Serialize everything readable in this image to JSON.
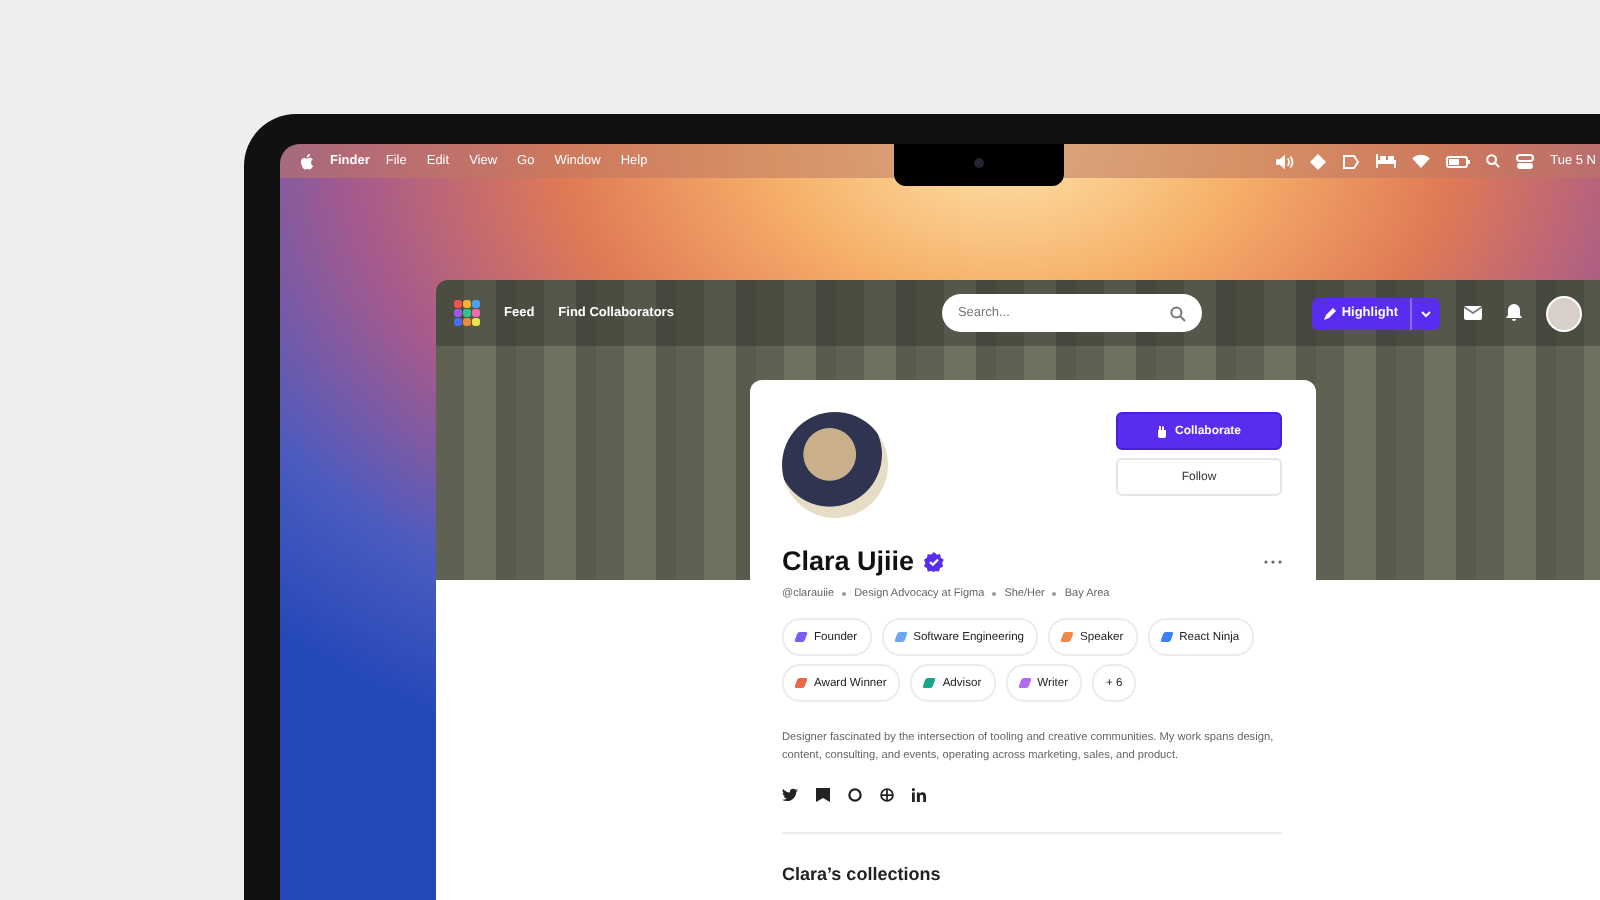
{
  "menubar": {
    "app": "Finder",
    "menus": [
      "File",
      "Edit",
      "View",
      "Go",
      "Window",
      "Help"
    ],
    "clock": "Tue 5 N"
  },
  "navbar": {
    "links": [
      "Feed",
      "Find Collaborators"
    ],
    "search": {
      "placeholder": "Search..."
    },
    "highlight_button": "Highlight"
  },
  "profile": {
    "name": "Clara Ujiie",
    "verified": true,
    "meta": [
      "@clarauiie",
      "Design Advocacy at Figma",
      "She/Her",
      "Bay Area"
    ],
    "actions": [
      {
        "label": "Collaborate",
        "kind": "primary"
      },
      {
        "label": "Follow",
        "kind": "secondary"
      }
    ],
    "tags": [
      {
        "label": "Founder",
        "color": "#7c5cf0",
        "kind": "tag"
      },
      {
        "label": "Software Engineering",
        "color": "#6aa7f0",
        "kind": "tag"
      },
      {
        "label": "Speaker",
        "color": "#f08a4b",
        "kind": "tag"
      },
      {
        "label": "React Ninja",
        "color": "#3b82f6",
        "kind": "tag"
      },
      {
        "label": "Award Winner",
        "color": "#e8684a",
        "kind": "tag"
      },
      {
        "label": "Advisor",
        "color": "#1aa58a",
        "kind": "tag"
      },
      {
        "label": "Writer",
        "color": "#b36cf0",
        "kind": "tag"
      },
      {
        "label": "+ 6",
        "kind": "more"
      }
    ],
    "bio": "Designer fascinated by the intersection of tooling and creative communities. My work spans design, content, consulting, and events, operating across marketing, sales, and product.",
    "collections_heading": "Clara’s collections"
  }
}
